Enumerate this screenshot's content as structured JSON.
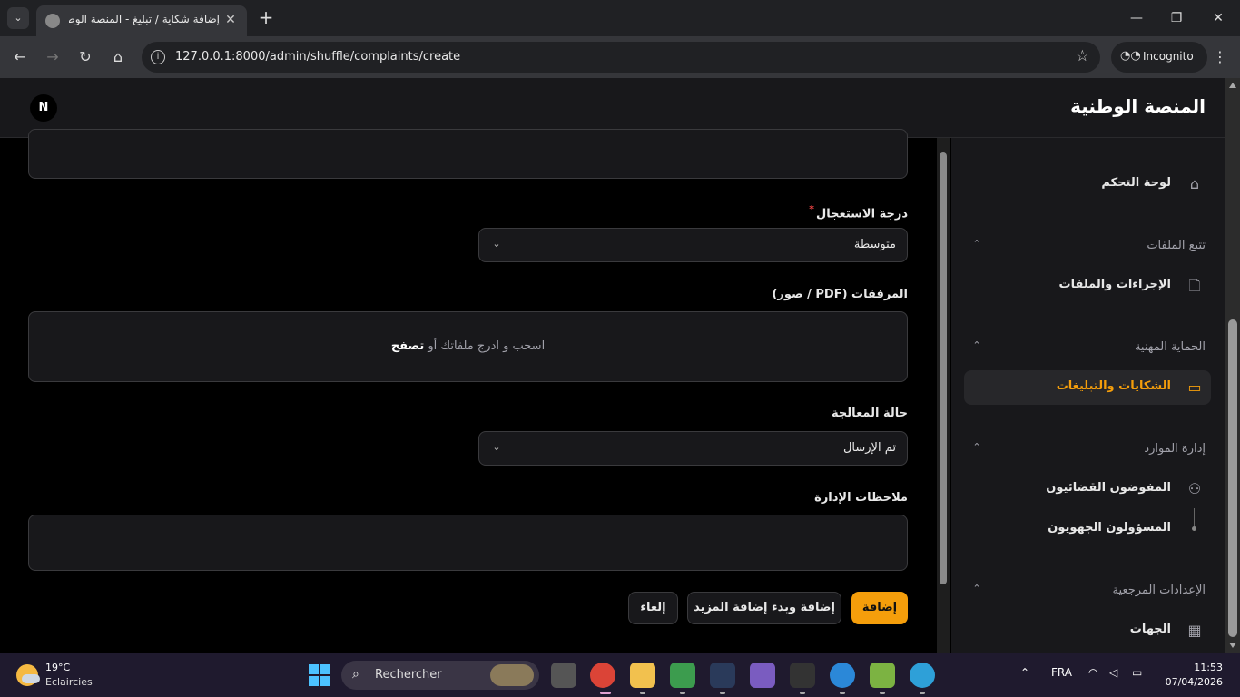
{
  "browser": {
    "tab_title": "إضافة شكاية / تبليغ - المنصة الوطنية",
    "new_tab_label": "+",
    "url": "127.0.0.1:8000/admin/shuffle/complaints/create",
    "incognito_label": "Incognito"
  },
  "header": {
    "brand": "المنصة الوطنية",
    "avatar_initial": "N"
  },
  "sidebar": {
    "dashboard": "لوحة التحكم",
    "groups": [
      {
        "label": "تتبع الملفات",
        "items": [
          "الإجراءات والملفات"
        ]
      },
      {
        "label": "الحماية المهنية",
        "items": [
          "الشكايات والتبليغات"
        ]
      },
      {
        "label": "إدارة الموارد",
        "items": [
          "المفوضون القضائيون",
          "المسؤولون الجهويون"
        ]
      },
      {
        "label": "الإعدادات المرجعية",
        "items": [
          "الجهات"
        ]
      }
    ],
    "active_item": "الشكايات والتبليغات"
  },
  "form": {
    "urgency_label": "درجة الاستعجال",
    "urgency_required": "*",
    "urgency_value": "متوسطة",
    "attachments_label": "المرفقات (PDF / صور)",
    "dropzone_text": "اسحب و ادرج ملفاتك أو",
    "dropzone_link": "تصفح",
    "status_label": "حالة المعالجة",
    "status_value": "تم الإرسال",
    "notes_label": "ملاحظات الإدارة",
    "notes_value": ""
  },
  "actions": {
    "create": "إضافة",
    "create_another": "إضافة وبدء إضافة المزيد",
    "cancel": "إلغاء"
  },
  "taskbar": {
    "weather_temp": "19°C",
    "weather_desc": "Eclaircies",
    "search_placeholder": "Rechercher",
    "language": "FRA",
    "time": "11:53",
    "date": "07/04/2026"
  },
  "colors": {
    "accent": "#f59e0b",
    "surface": "#18181b",
    "background": "#000000"
  }
}
